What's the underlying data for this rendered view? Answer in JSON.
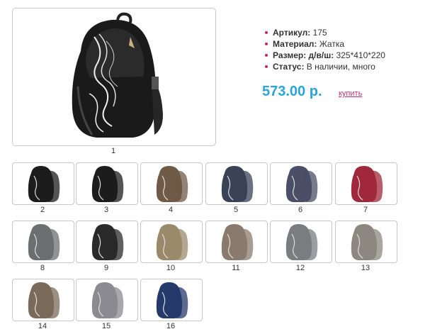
{
  "product": {
    "main_caption": "1",
    "properties": [
      {
        "label": "Артикул:",
        "value": "175"
      },
      {
        "label": "Материал:",
        "value": "Жатка"
      },
      {
        "label": "Размер: д/в/ш:",
        "value": "325*410*220"
      },
      {
        "label": "Статус:",
        "value": "В наличии, много"
      }
    ],
    "price": "573.00 р.",
    "buy_label": "купить"
  },
  "thumbnails": [
    {
      "caption": "2",
      "color": "#1c1c1c"
    },
    {
      "caption": "3",
      "color": "#1c1c1c"
    },
    {
      "caption": "4",
      "color": "#6e5a45"
    },
    {
      "caption": "5",
      "color": "#3a4256"
    },
    {
      "caption": "6",
      "color": "#4a4e66"
    },
    {
      "caption": "7",
      "color": "#a0283a"
    },
    {
      "caption": "8",
      "color": "#6c6e72"
    },
    {
      "caption": "9",
      "color": "#2a2a2a"
    },
    {
      "caption": "10",
      "color": "#9a8a6a"
    },
    {
      "caption": "11",
      "color": "#8a7a6e"
    },
    {
      "caption": "12",
      "color": "#7a7c80"
    },
    {
      "caption": "13",
      "color": "#8c8880"
    },
    {
      "caption": "14",
      "color": "#7a6a5a"
    },
    {
      "caption": "15",
      "color": "#8a8a90"
    },
    {
      "caption": "16",
      "color": "#243a6a"
    }
  ]
}
